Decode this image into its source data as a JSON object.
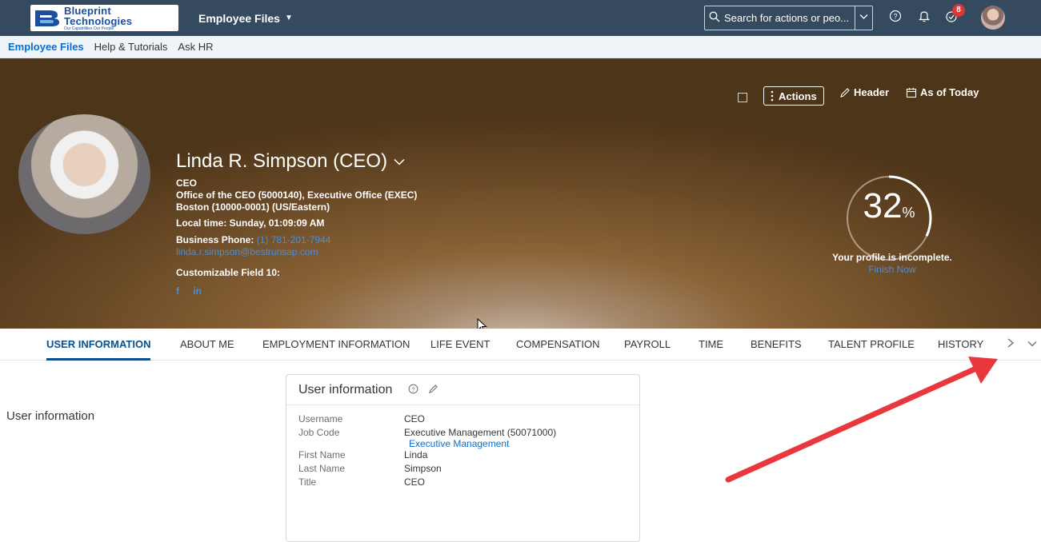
{
  "topbar": {
    "logo": {
      "line1": "Blueprint",
      "line2": "Technologies",
      "tagline": "Our Capabilities Our People",
      "brand_color": "#1d4e9e"
    },
    "app_title": "Employee Files",
    "search_placeholder": "Search for actions or peo...",
    "notification_count": "8",
    "icons": [
      "search-icon",
      "chevron-down-icon",
      "help-icon",
      "bell-icon",
      "notification-icon",
      "avatar"
    ]
  },
  "subnav": {
    "items": [
      {
        "label": "Employee Files",
        "active": true
      },
      {
        "label": "Help & Tutorials",
        "active": false
      },
      {
        "label": "Ask HR",
        "active": false
      }
    ]
  },
  "header": {
    "actions_label": "Actions",
    "header_label": "Header",
    "as_of_label": "As of Today",
    "name": "Linda R. Simpson (CEO)",
    "title": "CEO",
    "department": "Office of the CEO (5000140), Executive Office (EXEC)",
    "location": "Boston (10000-0001) (US/Eastern)",
    "local_time": "Local time: Sunday, 01:09:09 AM",
    "business_phone_label": "Business Phone:",
    "business_phone": "(1) 781-201-7944",
    "email": "linda.r.simpson@bestrunsap.com",
    "custom_field": "Customizable Field 10:",
    "social": {
      "facebook": "f",
      "linkedin": "in"
    },
    "profile_percent": "32",
    "percent_unit": "%",
    "profile_completion": 0.32,
    "incomplete_text": "Your profile is incomplete.",
    "finish_now": "Finish Now"
  },
  "tabs": [
    {
      "label": "USER INFORMATION",
      "active": true
    },
    {
      "label": "ABOUT ME",
      "active": false
    },
    {
      "label": "EMPLOYMENT INFORMATION",
      "active": false
    },
    {
      "label": "LIFE EVENT",
      "active": false
    },
    {
      "label": "COMPENSATION",
      "active": false
    },
    {
      "label": "PAYROLL",
      "active": false
    },
    {
      "label": "TIME",
      "active": false
    },
    {
      "label": "BENEFITS",
      "active": false
    },
    {
      "label": "TALENT PROFILE",
      "active": false
    },
    {
      "label": "HISTORY",
      "active": false
    }
  ],
  "main": {
    "section_label": "User information",
    "card": {
      "title": "User information",
      "rows": [
        {
          "label": "Username",
          "value": "CEO",
          "sub": ""
        },
        {
          "label": "Job Code",
          "value": "Executive Management (50071000)",
          "sub": "Executive Management"
        },
        {
          "label": "First Name",
          "value": "Linda",
          "sub": ""
        },
        {
          "label": "Last Name",
          "value": "Simpson",
          "sub": ""
        },
        {
          "label": "Title",
          "value": "CEO",
          "sub": ""
        }
      ]
    }
  },
  "colors": {
    "topbar": "#354a5f",
    "link": "#0a6ed1",
    "annotation_arrow": "#e8383d"
  }
}
